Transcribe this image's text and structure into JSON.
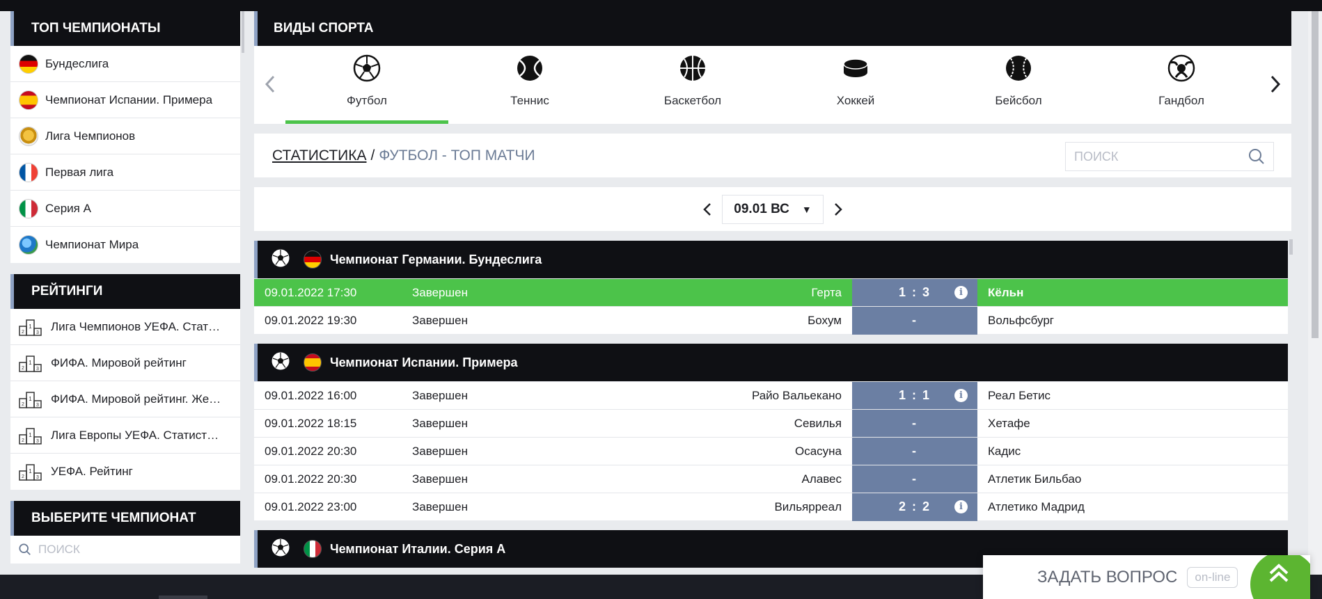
{
  "sidebar": {
    "top_title": "ТОП ЧЕМПИОНАТЫ",
    "top_items": [
      {
        "label": "Бундеслига",
        "flag": "de"
      },
      {
        "label": "Чемпионат Испании. Примера",
        "flag": "es"
      },
      {
        "label": "Лига Чемпионов",
        "flag": "cup"
      },
      {
        "label": "Первая лига",
        "flag": "fr"
      },
      {
        "label": "Серия А",
        "flag": "it"
      },
      {
        "label": "Чемпионат Мира",
        "flag": "world"
      }
    ],
    "ratings_title": "РЕЙТИНГИ",
    "ratings_items": [
      {
        "label": "Лига Чемпионов УЕФА. Стат…"
      },
      {
        "label": "ФИФА. Мировой рейтинг"
      },
      {
        "label": "ФИФА. Мировой рейтинг. Же…"
      },
      {
        "label": "Лига Европы УЕФА. Статист…"
      },
      {
        "label": "УЕФА. Рейтинг"
      }
    ],
    "choose_title": "ВЫБЕРИТЕ ЧЕМПИОНАТ",
    "choose_placeholder": "ПОИСК"
  },
  "sports": {
    "title": "ВИДЫ СПОРТА",
    "items": [
      {
        "label": "Футбол",
        "icon": "soccer-ball-icon",
        "active": true
      },
      {
        "label": "Теннис",
        "icon": "tennis-ball-icon",
        "active": false
      },
      {
        "label": "Баскетбол",
        "icon": "basketball-icon",
        "active": false
      },
      {
        "label": "Хоккей",
        "icon": "hockey-puck-icon",
        "active": false
      },
      {
        "label": "Бейсбол",
        "icon": "baseball-icon",
        "active": false
      },
      {
        "label": "Гандбол",
        "icon": "handball-icon",
        "active": false
      }
    ]
  },
  "breadcrumb": {
    "link": "СТАТИСТИКА",
    "separator": "/",
    "current": "ФУТБОЛ - ТОП МАТЧИ",
    "search_placeholder": "ПОИСК"
  },
  "date": {
    "value": "09.01 ВС"
  },
  "leagues": [
    {
      "name": "Чемпионат Германии. Бундеслига",
      "flag": "de",
      "matches": [
        {
          "time": "09.01.2022 17:30",
          "status": "Завершен",
          "home": "Герта",
          "score": "1 : 3",
          "info": true,
          "away": "Кёльн",
          "highlight": true
        },
        {
          "time": "09.01.2022 19:30",
          "status": "Завершен",
          "home": "Бохум",
          "score": "-",
          "info": false,
          "away": "Вольфсбург",
          "highlight": false
        }
      ]
    },
    {
      "name": "Чемпионат Испании. Примера",
      "flag": "es",
      "matches": [
        {
          "time": "09.01.2022 16:00",
          "status": "Завершен",
          "home": "Райо Вальекано",
          "score": "1 : 1",
          "info": true,
          "away": "Реал Бетис",
          "highlight": false
        },
        {
          "time": "09.01.2022 18:15",
          "status": "Завершен",
          "home": "Севилья",
          "score": "-",
          "info": false,
          "away": "Хетафе",
          "highlight": false
        },
        {
          "time": "09.01.2022 20:30",
          "status": "Завершен",
          "home": "Осасуна",
          "score": "-",
          "info": false,
          "away": "Кадис",
          "highlight": false
        },
        {
          "time": "09.01.2022 20:30",
          "status": "Завершен",
          "home": "Алавес",
          "score": "-",
          "info": false,
          "away": "Атлетик Бильбао",
          "highlight": false
        },
        {
          "time": "09.01.2022 23:00",
          "status": "Завершен",
          "home": "Вильярреал",
          "score": "2 : 2",
          "info": true,
          "away": "Атлетико Мадрид",
          "highlight": false
        }
      ]
    },
    {
      "name": "Чемпионат Италии. Серия А",
      "flag": "it",
      "matches": []
    }
  ],
  "ask": {
    "label": "ЗАДАТЬ ВОПРОС",
    "status": "on-line"
  },
  "colors": {
    "accent_green": "#4cc34a",
    "header_dark": "#0f1014",
    "score_bg": "#6b7fa3",
    "header_stripe": "#8ea2c4"
  }
}
